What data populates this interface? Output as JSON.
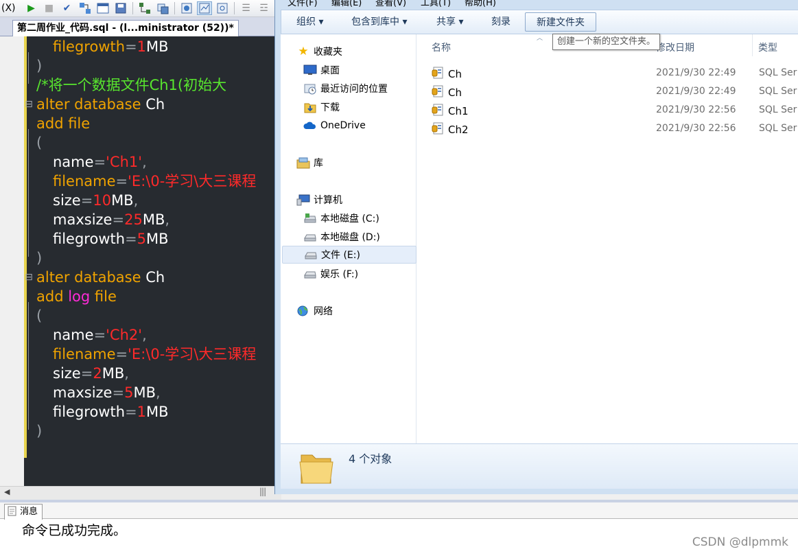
{
  "ssms": {
    "menu_fragment": "(X)",
    "doc_tab_title": "第二周作业_代码.sql - (l...ministrator (52))*",
    "code_lines": [
      {
        "parts": [
          {
            "t": "filegrowth",
            "c": "c-kw"
          },
          {
            "t": "=",
            "c": "c-op"
          },
          {
            "t": "1",
            "c": "c-num"
          },
          {
            "t": "MB",
            "c": "c-id"
          }
        ],
        "indent": 2
      },
      {
        "parts": [
          {
            "t": ")",
            "c": "c-op"
          }
        ],
        "indent": 0
      },
      {
        "parts": [
          {
            "t": "/*将一个数据文件Ch1(初始大",
            "c": "c-cm"
          }
        ],
        "indent": 1
      },
      {
        "parts": [
          {
            "t": "alter database ",
            "c": "c-kw"
          },
          {
            "t": "Ch",
            "c": "c-id"
          }
        ],
        "indent": 1
      },
      {
        "parts": [
          {
            "t": "add file",
            "c": "c-kw"
          }
        ],
        "indent": 1
      },
      {
        "parts": [
          {
            "t": "(",
            "c": "c-op"
          }
        ],
        "indent": 1
      },
      {
        "parts": [
          {
            "t": "name",
            "c": "c-id"
          },
          {
            "t": "=",
            "c": "c-op"
          },
          {
            "t": "'Ch1'",
            "c": "c-str"
          },
          {
            "t": ",",
            "c": "c-op"
          }
        ],
        "indent": 2
      },
      {
        "parts": [
          {
            "t": "filename",
            "c": "c-kw"
          },
          {
            "t": "=",
            "c": "c-op"
          },
          {
            "t": "'E:\\0-学习\\大三课程",
            "c": "c-str"
          }
        ],
        "indent": 2
      },
      {
        "parts": [
          {
            "t": "size",
            "c": "c-id"
          },
          {
            "t": "=",
            "c": "c-op"
          },
          {
            "t": "10",
            "c": "c-num"
          },
          {
            "t": "MB",
            "c": "c-id"
          },
          {
            "t": ",",
            "c": "c-op"
          }
        ],
        "indent": 2
      },
      {
        "parts": [
          {
            "t": "maxsize",
            "c": "c-id"
          },
          {
            "t": "=",
            "c": "c-op"
          },
          {
            "t": "25",
            "c": "c-num"
          },
          {
            "t": "MB",
            "c": "c-id"
          },
          {
            "t": ",",
            "c": "c-op"
          }
        ],
        "indent": 2
      },
      {
        "parts": [
          {
            "t": "filegrowth",
            "c": "c-id"
          },
          {
            "t": "=",
            "c": "c-op"
          },
          {
            "t": "5",
            "c": "c-num"
          },
          {
            "t": "MB",
            "c": "c-id"
          }
        ],
        "indent": 2
      },
      {
        "parts": [
          {
            "t": ")",
            "c": "c-op"
          }
        ],
        "indent": 0
      },
      {
        "parts": [
          {
            "t": "alter database ",
            "c": "c-kw"
          },
          {
            "t": "Ch",
            "c": "c-id"
          }
        ],
        "indent": 1
      },
      {
        "parts": [
          {
            "t": "add ",
            "c": "c-kw"
          },
          {
            "t": "log",
            "c": "c-mag"
          },
          {
            "t": " file",
            "c": "c-kw"
          }
        ],
        "indent": 1
      },
      {
        "parts": [
          {
            "t": "(",
            "c": "c-op"
          }
        ],
        "indent": 1
      },
      {
        "parts": [
          {
            "t": "name",
            "c": "c-id"
          },
          {
            "t": "=",
            "c": "c-op"
          },
          {
            "t": "'Ch2'",
            "c": "c-str"
          },
          {
            "t": ",",
            "c": "c-op"
          }
        ],
        "indent": 2
      },
      {
        "parts": [
          {
            "t": "filename",
            "c": "c-kw"
          },
          {
            "t": "=",
            "c": "c-op"
          },
          {
            "t": "'E:\\0-学习\\大三课程",
            "c": "c-str"
          }
        ],
        "indent": 2
      },
      {
        "parts": [
          {
            "t": "size",
            "c": "c-id"
          },
          {
            "t": "=",
            "c": "c-op"
          },
          {
            "t": "2",
            "c": "c-num"
          },
          {
            "t": "MB",
            "c": "c-id"
          },
          {
            "t": ",",
            "c": "c-op"
          }
        ],
        "indent": 2
      },
      {
        "parts": [
          {
            "t": "maxsize",
            "c": "c-id"
          },
          {
            "t": "=",
            "c": "c-op"
          },
          {
            "t": "5",
            "c": "c-num"
          },
          {
            "t": "MB",
            "c": "c-id"
          },
          {
            "t": ",",
            "c": "c-op"
          }
        ],
        "indent": 2
      },
      {
        "parts": [
          {
            "t": "filegrowth",
            "c": "c-id"
          },
          {
            "t": "=",
            "c": "c-op"
          },
          {
            "t": "1",
            "c": "c-num"
          },
          {
            "t": "MB",
            "c": "c-id"
          }
        ],
        "indent": 2
      },
      {
        "parts": [
          {
            "t": ")",
            "c": "c-op"
          }
        ],
        "indent": 0
      }
    ],
    "messages_tab_label": "消息",
    "message_text": "命令已成功完成。"
  },
  "explorer": {
    "menu": [
      "文件(F)",
      "编辑(E)",
      "查看(V)",
      "工具(T)",
      "帮助(H)"
    ],
    "toolbar": {
      "organize": "组织 ▾",
      "include_in_library": "包含到库中 ▾",
      "share": "共享 ▾",
      "burn": "刻录",
      "new_folder": "新建文件夹"
    },
    "tooltip": "创建一个新的空文件夹。",
    "nav": {
      "favorites": "收藏夹",
      "desktop": "桌面",
      "recent": "最近访问的位置",
      "downloads": "下载",
      "onedrive": "OneDrive",
      "libraries": "库",
      "computer": "计算机",
      "drive_c": "本地磁盘 (C:)",
      "drive_d": "本地磁盘 (D:)",
      "drive_e": "文件 (E:)",
      "drive_f": "娱乐 (F:)",
      "network": "网络"
    },
    "columns": {
      "name": "名称",
      "date": "修改日期",
      "type": "类型"
    },
    "files": [
      {
        "name": "Ch",
        "date": "2021/9/30 22:49",
        "type": "SQL Ser"
      },
      {
        "name": "Ch",
        "date": "2021/9/30 22:49",
        "type": "SQL Ser"
      },
      {
        "name": "Ch1",
        "date": "2021/9/30 22:56",
        "type": "SQL Ser"
      },
      {
        "name": "Ch2",
        "date": "2021/9/30 22:56",
        "type": "SQL Ser"
      }
    ],
    "status": "4 个对象"
  },
  "watermark": "CSDN @dlpmmk",
  "colors": {
    "editor_bg": "#272b30",
    "keyword": "#f0a300",
    "string": "#ff2a2a",
    "comment": "#58e62e",
    "nav_selected": "#e5eefa"
  }
}
